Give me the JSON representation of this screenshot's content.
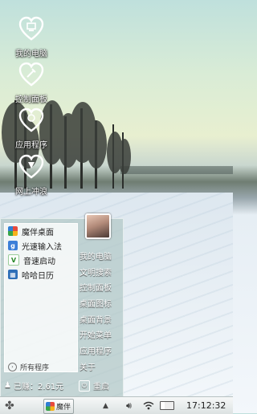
{
  "desktop": {
    "icons": [
      {
        "label": "我的电脑",
        "icon": "heart-computer-icon"
      },
      {
        "label": "控制面板",
        "icon": "heart-wrench-icon"
      },
      {
        "label": "应用程序",
        "icon": "heart-apps-icon"
      },
      {
        "label": "网上冲浪",
        "icon": "heart-globe-icon"
      }
    ]
  },
  "start_menu": {
    "apps": [
      {
        "label": "魔伴桌面",
        "icon": "mobanzhuomian-icon"
      },
      {
        "label": "光速输入法",
        "icon": "guangsu-input-icon"
      },
      {
        "label": "音速启动",
        "icon": "yinsu-launch-icon"
      },
      {
        "label": "哈哈日历",
        "icon": "haha-calendar-icon"
      }
    ],
    "all_programs": "所有程序",
    "right_items": [
      "我的电脑",
      "文明搜索",
      "控制面板",
      "桌面图标",
      "桌面背景",
      "开始菜单",
      "应用程序",
      "关于"
    ],
    "balance": "已赚：2.61元",
    "restart": "重启"
  },
  "taskbar": {
    "task_label": "魔伴",
    "clock": "17:12:32"
  },
  "colors": {
    "menu_glass": "#b2c8c6",
    "taskbar": "#e6eaea"
  }
}
